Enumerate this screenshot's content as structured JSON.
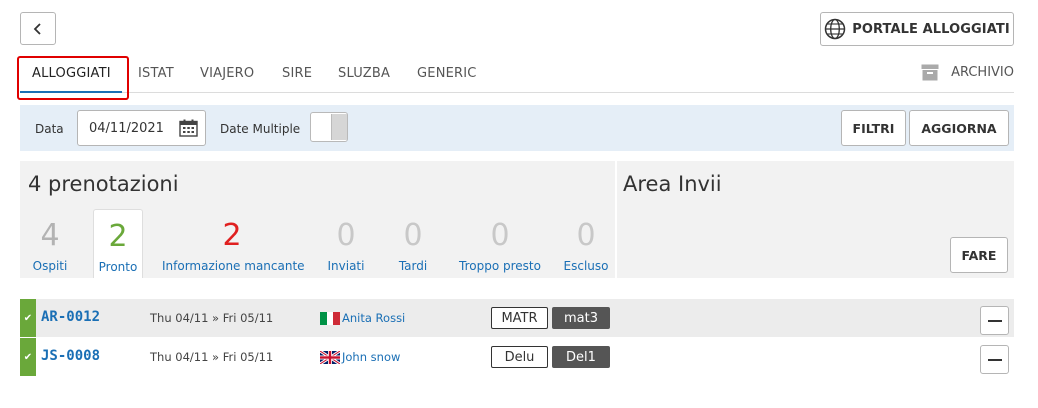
{
  "header": {
    "back_icon": "chevron-left-icon",
    "portal_label": "PORTALE ALLOGGIATI",
    "portal_icon": "globe-icon"
  },
  "tabs": [
    {
      "label": "ALLOGGIATI",
      "active": true
    },
    {
      "label": "ISTAT",
      "active": false
    },
    {
      "label": "VIAJERO",
      "active": false
    },
    {
      "label": "SIRE",
      "active": false
    },
    {
      "label": "SLUZBA",
      "active": false
    },
    {
      "label": "GENERIC",
      "active": false
    }
  ],
  "archive": {
    "label": "ARCHIVIO",
    "icon": "archive-box-icon"
  },
  "filters": {
    "date_label": "Data",
    "date_value": "04/11/2021",
    "date_icon": "calendar-icon",
    "multiple_label": "Date Multiple",
    "filter_button": "FILTRI",
    "refresh_button": "AGGIORNA"
  },
  "summary": {
    "title": "4 prenotazioni",
    "stats": [
      {
        "value": "4",
        "label": "Ospiti",
        "color": "#b3b3b3"
      },
      {
        "value": "2",
        "label": "Pronto",
        "color": "#6aa83a",
        "active": true
      },
      {
        "value": "2",
        "label": "Informazione mancante",
        "color": "#e02020"
      },
      {
        "value": "0",
        "label": "Inviati",
        "color": "#c8c8c8"
      },
      {
        "value": "0",
        "label": "Tardi",
        "color": "#c8c8c8"
      },
      {
        "value": "0",
        "label": "Troppo presto",
        "color": "#c8c8c8"
      },
      {
        "value": "0",
        "label": "Escluso",
        "color": "#c8c8c8"
      }
    ]
  },
  "send_area": {
    "title": "Area Invii",
    "button": "FARE"
  },
  "bookings": [
    {
      "code": "AR-0012",
      "dates": "Thu 04/11 » Fri 05/11",
      "flag": "italy-flag-icon",
      "guest": "Anita Rossi",
      "tag1": "MATR",
      "tag2": "mat3"
    },
    {
      "code": "JS-0008",
      "dates": "Thu 04/11 » Fri 05/11",
      "flag": "uk-flag-icon",
      "guest": "John snow",
      "tag1": "Delu",
      "tag2": "Del1"
    }
  ],
  "colors": {
    "accent": "#1a6fb5",
    "ready": "#6aa83a",
    "missing": "#e02020",
    "filterbar": "#e5eef7"
  }
}
